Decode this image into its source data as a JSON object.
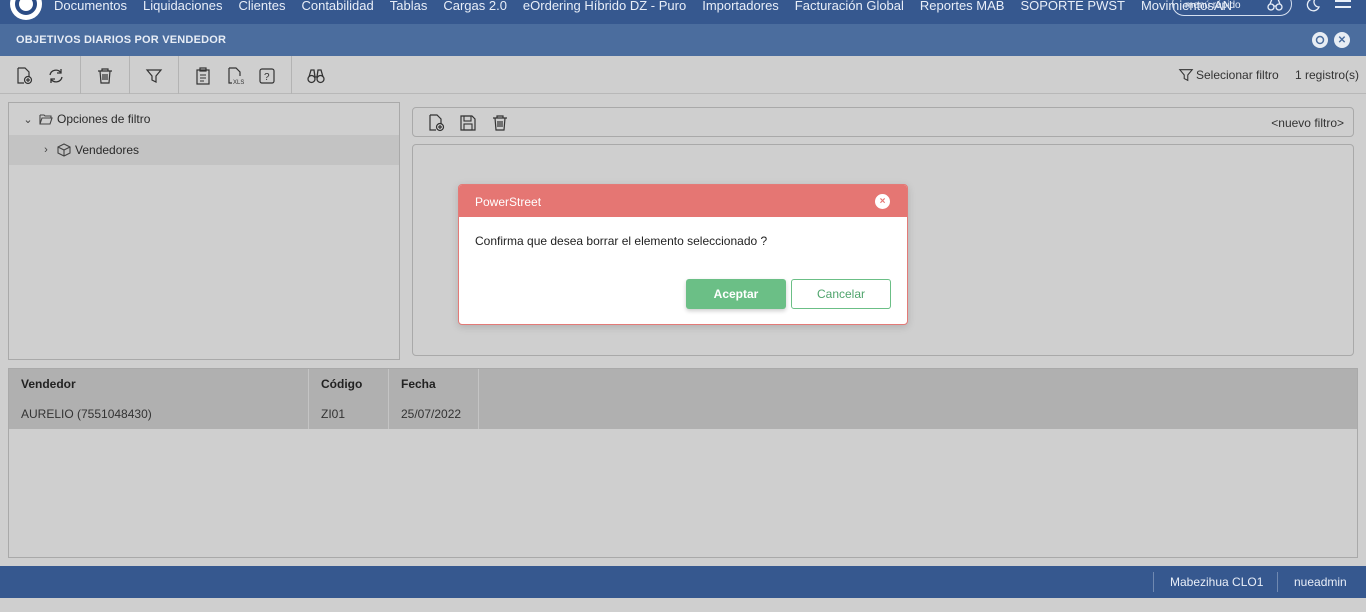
{
  "nav": {
    "items": [
      "Documentos",
      "Liquidaciones",
      "Clientes",
      "Contabilidad",
      "Tablas",
      "Cargas 2.0",
      "eOrdering Híbrido DZ - Puro",
      "Importadores",
      "Facturación Global",
      "Reportes MAB",
      "SOPORTE PWST",
      "MovimientosAN"
    ],
    "quick_menu_placeholder": "menú rápido"
  },
  "page": {
    "title": "OBJETIVOS DIARIOS POR VENDEDOR"
  },
  "toolbar": {
    "select_filter_label": "Selecionar filtro",
    "record_count": "1 registro(s)"
  },
  "tree": {
    "root_label": "Opciones de filtro",
    "child_label": "Vendedores"
  },
  "filter_panel": {
    "new_filter_label": "<nuevo filtro>"
  },
  "grid": {
    "columns": [
      "Vendedor",
      "Código",
      "Fecha"
    ],
    "rows": [
      [
        "AURELIO (7551048430)",
        "ZI01",
        "25/07/2022"
      ]
    ]
  },
  "footer": {
    "company": "Mabezihua CLO1",
    "user": "nueadmin"
  },
  "dialog": {
    "title": "PowerStreet",
    "message": "Confirma que desea borrar el elemento seleccionado ?",
    "accept_label": "Aceptar",
    "cancel_label": "Cancelar",
    "close_glyph": "×"
  },
  "colors": {
    "nav_bg": "#36588f",
    "title_bg": "#4b6d9e",
    "dialog_header": "#e57673",
    "accept_button": "#6bbf86"
  },
  "icons": {
    "toolbar": [
      "new-document-icon",
      "refresh-icon",
      "trash-icon",
      "filter-icon",
      "clipboard-icon",
      "export-xls-icon",
      "help-icon",
      "binoculars-icon"
    ],
    "filter_panel": [
      "new-document-icon",
      "save-icon",
      "trash-icon"
    ]
  }
}
